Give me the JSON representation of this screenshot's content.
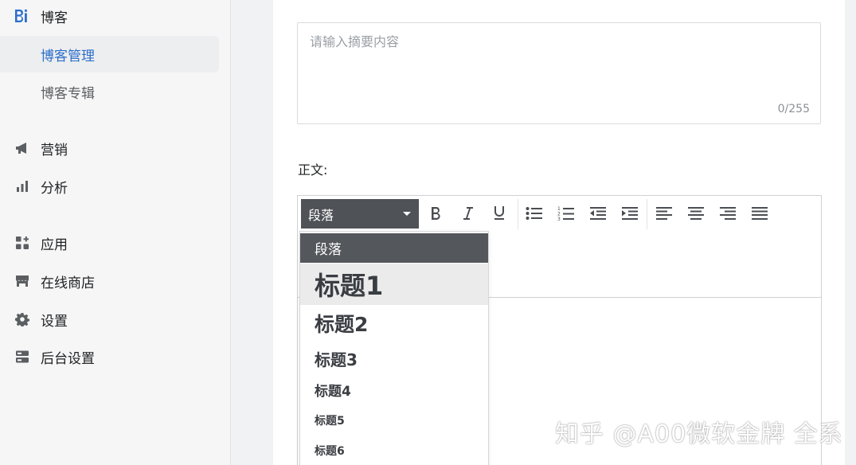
{
  "sidebar": {
    "blog": {
      "label": "博客",
      "icon": "blog-icon"
    },
    "blog_manage": {
      "label": "博客管理"
    },
    "blog_album": {
      "label": "博客专辑"
    },
    "marketing": {
      "label": "营销",
      "icon": "megaphone-icon"
    },
    "analytics": {
      "label": "分析",
      "icon": "bar-chart-icon"
    },
    "apps": {
      "label": "应用",
      "icon": "apps-icon"
    },
    "store": {
      "label": "在线商店",
      "icon": "store-icon"
    },
    "settings": {
      "label": "设置",
      "icon": "gear-icon"
    },
    "admin": {
      "label": "后台设置",
      "icon": "server-icon"
    }
  },
  "form": {
    "summary_placeholder": "请输入摘要内容",
    "summary_count": "0/255",
    "body_label": "正文:"
  },
  "editor": {
    "format_value": "段落",
    "dropdown": [
      {
        "label": "段落"
      },
      {
        "label": "标题1"
      },
      {
        "label": "标题2"
      },
      {
        "label": "标题3"
      },
      {
        "label": "标题4"
      },
      {
        "label": "标题5"
      },
      {
        "label": "标题6"
      }
    ]
  },
  "watermark": "知乎 @A00微软金牌 全系",
  "colors": {
    "accent": "#2c6ecb",
    "select_bg": "#4f5257"
  }
}
